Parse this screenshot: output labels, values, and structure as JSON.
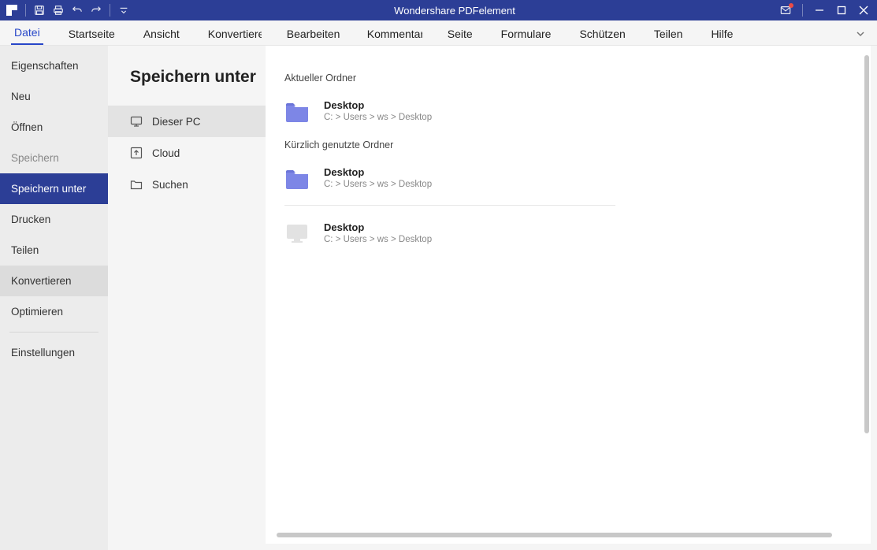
{
  "app": {
    "title": "Wondershare PDFelement"
  },
  "ribbon": {
    "tabs": [
      "Datei",
      "Startseite",
      "Ansicht",
      "Konvertieren",
      "Bearbeiten",
      "Kommentar",
      "Seite",
      "Formulare",
      "Schützen",
      "Teilen",
      "Hilfe"
    ],
    "active_index": 0
  },
  "file_menu": {
    "items": [
      {
        "label": "Eigenschaften",
        "state": "normal"
      },
      {
        "label": "Neu",
        "state": "normal"
      },
      {
        "label": "Öffnen",
        "state": "normal"
      },
      {
        "label": "Speichern",
        "state": "dim"
      },
      {
        "label": "Speichern unter",
        "state": "active"
      },
      {
        "label": "Drucken",
        "state": "normal"
      },
      {
        "label": "Teilen",
        "state": "normal"
      },
      {
        "label": "Konvertieren",
        "state": "hover"
      },
      {
        "label": "Optimieren",
        "state": "normal"
      }
    ],
    "settings_label": "Einstellungen"
  },
  "mid": {
    "header": "Speichern unter",
    "sources": [
      {
        "id": "this-pc",
        "label": "Dieser PC",
        "icon": "monitor",
        "active": true
      },
      {
        "id": "cloud",
        "label": "Cloud",
        "icon": "cloud-up",
        "active": false
      },
      {
        "id": "browse",
        "label": "Suchen",
        "icon": "folder",
        "active": false
      }
    ]
  },
  "right": {
    "current_folder_label": "Aktueller Ordner",
    "recent_folders_label": "Kürzlich genutzte Ordner",
    "current": {
      "name": "Desktop",
      "path": "C: > Users > ws > Desktop",
      "icon": "folder-blue"
    },
    "recents": [
      {
        "name": "Desktop",
        "path": "C: > Users > ws > Desktop",
        "icon": "folder-blue"
      },
      {
        "name": "Desktop",
        "path": "C: > Users > ws > Desktop",
        "icon": "monitor-gray"
      }
    ]
  }
}
